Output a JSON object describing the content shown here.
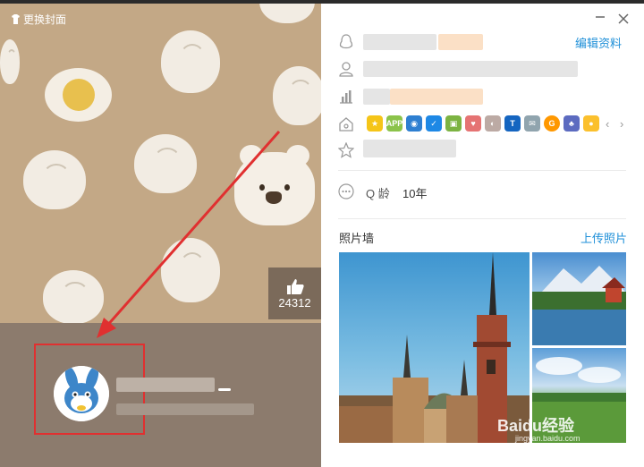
{
  "cover": {
    "change_cover_label": "更换封面",
    "likes": "24312"
  },
  "header": {
    "edit_profile_label": "编辑资料"
  },
  "profile": {
    "q_age_label": "Q 龄",
    "q_age_value": "10年"
  },
  "photo_wall": {
    "title": "照片墙",
    "upload_label": "上传照片"
  },
  "watermark": {
    "brand": "Baidu经验",
    "url": "jingyan.baidu.com"
  },
  "icons": [
    "penguin-icon",
    "person-icon",
    "chart-icon",
    "house-icon",
    "star-icon",
    "more-icon",
    "thumb-up-icon",
    "close-icon",
    "minimize-icon"
  ],
  "colors": {
    "accent": "#1e8fd8",
    "cover_bg": "#c3a886",
    "highlight": "#e03030"
  }
}
